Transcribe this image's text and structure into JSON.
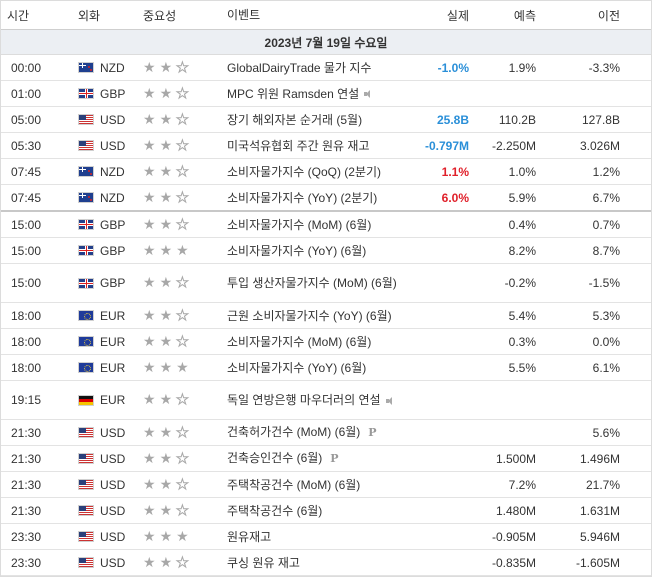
{
  "header": {
    "time": "시간",
    "currency": "외화",
    "importance": "중요성",
    "event": "이벤트",
    "actual": "실제",
    "forecast": "예측",
    "previous": "이전"
  },
  "date_label": "2023년 7월 19일 수요일",
  "icons": {
    "star": "★",
    "speaker": "speaker-icon",
    "preliminary": "P"
  },
  "colors": {
    "actual_better": "#2a8fd8",
    "actual_worse": "#e0202a"
  },
  "rows": [
    {
      "time": "00:00",
      "flag": "nz",
      "currency": "NZD",
      "stars": 2,
      "event": "GlobalDairyTrade 물가 지수",
      "actual": "-1.0%",
      "actual_color": "green",
      "forecast": "1.9%",
      "previous": "-3.3%",
      "speaker": false,
      "prelim": false,
      "tall": false,
      "sep": false
    },
    {
      "time": "01:00",
      "flag": "gb",
      "currency": "GBP",
      "stars": 2,
      "event": "MPC 위원 Ramsden 연설",
      "actual": "",
      "actual_color": "",
      "forecast": "",
      "previous": "",
      "speaker": true,
      "prelim": false,
      "tall": false,
      "sep": false
    },
    {
      "time": "05:00",
      "flag": "us",
      "currency": "USD",
      "stars": 2,
      "event": "장기 해외자본 순거래 (5월)",
      "actual": "25.8B",
      "actual_color": "green",
      "forecast": "110.2B",
      "previous": "127.8B",
      "speaker": false,
      "prelim": false,
      "tall": false,
      "sep": false
    },
    {
      "time": "05:30",
      "flag": "us",
      "currency": "USD",
      "stars": 2,
      "event": "미국석유협회 주간 원유 재고",
      "actual": "-0.797M",
      "actual_color": "green",
      "forecast": "-2.250M",
      "previous": "3.026M",
      "speaker": false,
      "prelim": false,
      "tall": false,
      "sep": false
    },
    {
      "time": "07:45",
      "flag": "nz",
      "currency": "NZD",
      "stars": 2,
      "event": "소비자물가지수 (QoQ) (2분기)",
      "actual": "1.1%",
      "actual_color": "red",
      "forecast": "1.0%",
      "previous": "1.2%",
      "speaker": false,
      "prelim": false,
      "tall": false,
      "sep": false
    },
    {
      "time": "07:45",
      "flag": "nz",
      "currency": "NZD",
      "stars": 2,
      "event": "소비자물가지수 (YoY) (2분기)",
      "actual": "6.0%",
      "actual_color": "red",
      "forecast": "5.9%",
      "previous": "6.7%",
      "speaker": false,
      "prelim": false,
      "tall": false,
      "sep": true
    },
    {
      "time": "15:00",
      "flag": "gb",
      "currency": "GBP",
      "stars": 2,
      "event": "소비자물가지수 (MoM) (6월)",
      "actual": "",
      "actual_color": "",
      "forecast": "0.4%",
      "previous": "0.7%",
      "speaker": false,
      "prelim": false,
      "tall": false,
      "sep": false
    },
    {
      "time": "15:00",
      "flag": "gb",
      "currency": "GBP",
      "stars": 3,
      "event": "소비자물가지수 (YoY) (6월)",
      "actual": "",
      "actual_color": "",
      "forecast": "8.2%",
      "previous": "8.7%",
      "speaker": false,
      "prelim": false,
      "tall": false,
      "sep": false
    },
    {
      "time": "15:00",
      "flag": "gb",
      "currency": "GBP",
      "stars": 2,
      "event": "투입 생산자물가지수 (MoM) (6월)",
      "actual": "",
      "actual_color": "",
      "forecast": "-0.2%",
      "previous": "-1.5%",
      "speaker": false,
      "prelim": false,
      "tall": true,
      "sep": false
    },
    {
      "time": "18:00",
      "flag": "eu",
      "currency": "EUR",
      "stars": 2,
      "event": "근원 소비자물가지수 (YoY) (6월)",
      "actual": "",
      "actual_color": "",
      "forecast": "5.4%",
      "previous": "5.3%",
      "speaker": false,
      "prelim": false,
      "tall": false,
      "sep": false
    },
    {
      "time": "18:00",
      "flag": "eu",
      "currency": "EUR",
      "stars": 2,
      "event": "소비자물가지수 (MoM) (6월)",
      "actual": "",
      "actual_color": "",
      "forecast": "0.3%",
      "previous": "0.0%",
      "speaker": false,
      "prelim": false,
      "tall": false,
      "sep": false
    },
    {
      "time": "18:00",
      "flag": "eu",
      "currency": "EUR",
      "stars": 3,
      "event": "소비자물가지수 (YoY) (6월)",
      "actual": "",
      "actual_color": "",
      "forecast": "5.5%",
      "previous": "6.1%",
      "speaker": false,
      "prelim": false,
      "tall": false,
      "sep": false
    },
    {
      "time": "19:15",
      "flag": "de",
      "currency": "EUR",
      "stars": 2,
      "event": "독일 연방은행 마우더러의 연설",
      "actual": "",
      "actual_color": "",
      "forecast": "",
      "previous": "",
      "speaker": true,
      "prelim": false,
      "tall": true,
      "sep": false
    },
    {
      "time": "21:30",
      "flag": "us",
      "currency": "USD",
      "stars": 2,
      "event": "건축허가건수 (MoM) (6월)",
      "actual": "",
      "actual_color": "",
      "forecast": "",
      "previous": "5.6%",
      "speaker": false,
      "prelim": true,
      "tall": false,
      "sep": false
    },
    {
      "time": "21:30",
      "flag": "us",
      "currency": "USD",
      "stars": 2,
      "event": "건축승인건수 (6월)",
      "actual": "",
      "actual_color": "",
      "forecast": "1.500M",
      "previous": "1.496M",
      "speaker": false,
      "prelim": true,
      "tall": false,
      "sep": false
    },
    {
      "time": "21:30",
      "flag": "us",
      "currency": "USD",
      "stars": 2,
      "event": "주택착공건수 (MoM) (6월)",
      "actual": "",
      "actual_color": "",
      "forecast": "7.2%",
      "previous": "21.7%",
      "speaker": false,
      "prelim": false,
      "tall": false,
      "sep": false
    },
    {
      "time": "21:30",
      "flag": "us",
      "currency": "USD",
      "stars": 2,
      "event": "주택착공건수 (6월)",
      "actual": "",
      "actual_color": "",
      "forecast": "1.480M",
      "previous": "1.631M",
      "speaker": false,
      "prelim": false,
      "tall": false,
      "sep": false
    },
    {
      "time": "23:30",
      "flag": "us",
      "currency": "USD",
      "stars": 3,
      "event": "원유재고",
      "actual": "",
      "actual_color": "",
      "forecast": "-0.905M",
      "previous": "5.946M",
      "speaker": false,
      "prelim": false,
      "tall": false,
      "sep": false
    },
    {
      "time": "23:30",
      "flag": "us",
      "currency": "USD",
      "stars": 2,
      "event": "쿠싱 원유 재고",
      "actual": "",
      "actual_color": "",
      "forecast": "-0.835M",
      "previous": "-1.605M",
      "speaker": false,
      "prelim": false,
      "tall": false,
      "sep": false
    }
  ]
}
